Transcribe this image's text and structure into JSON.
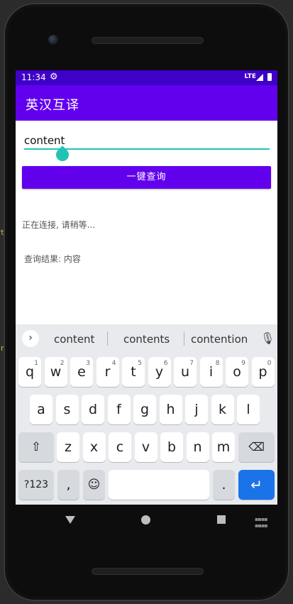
{
  "ide": {
    "left_text_1": "t",
    "left_text_2": "r"
  },
  "status_bar": {
    "time": "11:34",
    "network": "LTE",
    "settings_icon": "gear-icon"
  },
  "app": {
    "title": "英汉互译"
  },
  "search": {
    "value": "content"
  },
  "button": {
    "label": "一键查询"
  },
  "messages": {
    "status": "正在连接, 请稍等...",
    "result": "查询结果: 内容"
  },
  "keyboard": {
    "suggestions": [
      "content",
      "contents",
      "contention"
    ],
    "row1": [
      {
        "k": "q",
        "n": "1"
      },
      {
        "k": "w",
        "n": "2"
      },
      {
        "k": "e",
        "n": "3"
      },
      {
        "k": "r",
        "n": "4"
      },
      {
        "k": "t",
        "n": "5"
      },
      {
        "k": "y",
        "n": "6"
      },
      {
        "k": "u",
        "n": "7"
      },
      {
        "k": "i",
        "n": "8"
      },
      {
        "k": "o",
        "n": "9"
      },
      {
        "k": "p",
        "n": "0"
      }
    ],
    "row2": [
      "a",
      "s",
      "d",
      "f",
      "g",
      "h",
      "j",
      "k",
      "l"
    ],
    "row3": [
      "z",
      "x",
      "c",
      "v",
      "b",
      "n",
      "m"
    ],
    "symbols_label": "?123",
    "comma": ",",
    "period": "."
  },
  "colors": {
    "appbar": "#6200ee",
    "statusbar": "#3f00c8",
    "accent": "#1fc4b4",
    "enter": "#1a73e8"
  }
}
